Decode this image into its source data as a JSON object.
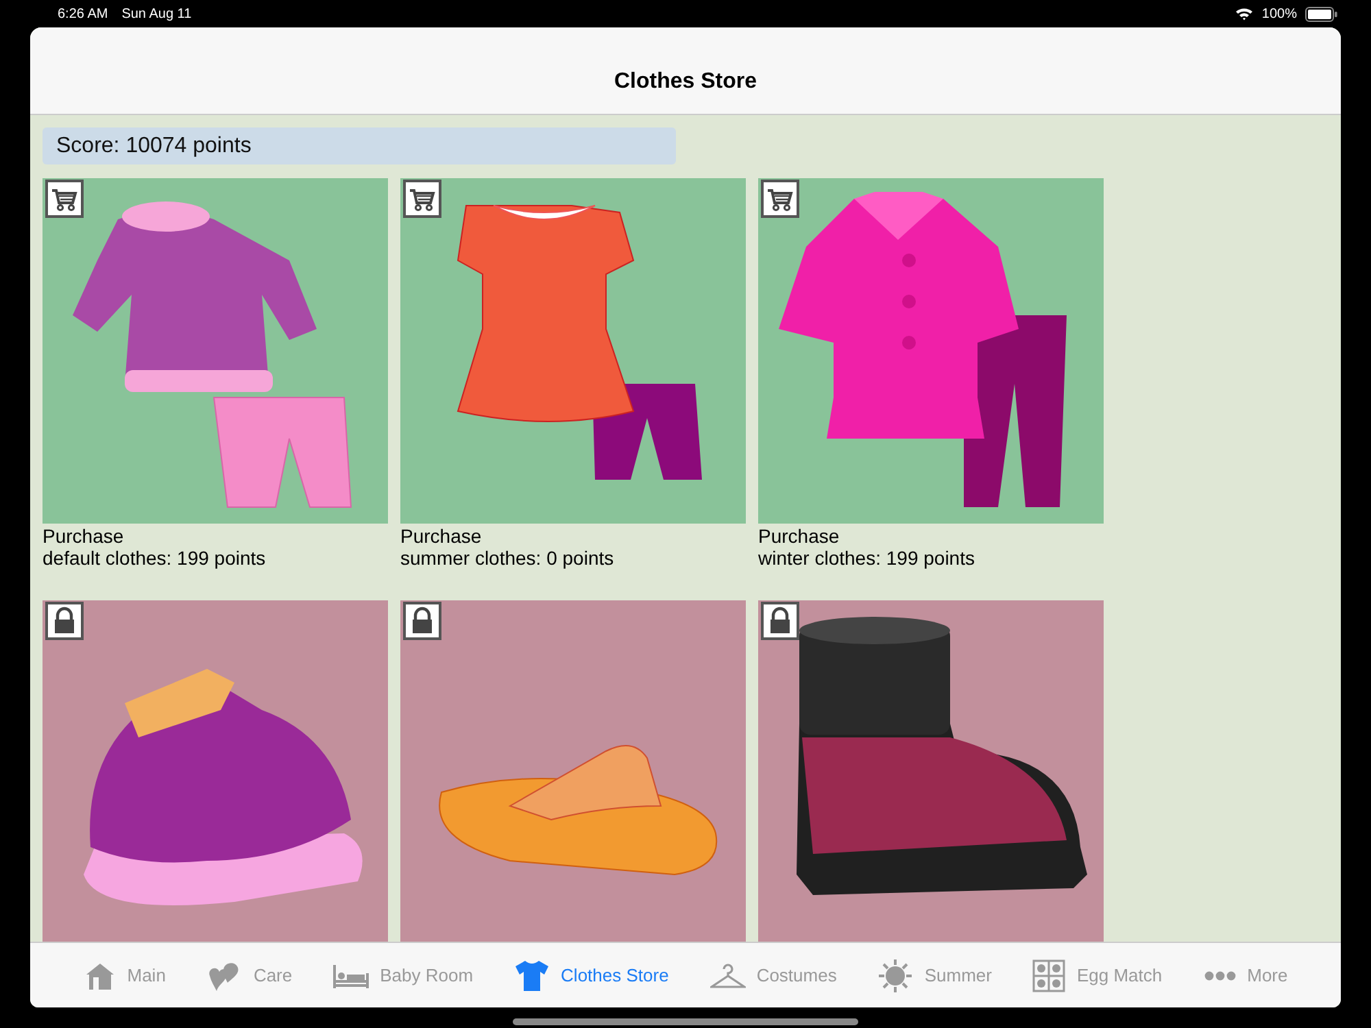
{
  "status_bar": {
    "time": "6:26 AM",
    "date": "Sun Aug 11",
    "battery": "100%"
  },
  "nav": {
    "title": "Clothes Store"
  },
  "score": "Score: 10074 points",
  "items": [
    {
      "kind": "purchase",
      "caption": [
        "Purchase",
        "default clothes: 199 points"
      ]
    },
    {
      "kind": "purchase",
      "caption": [
        "Purchase",
        "summer clothes: 0 points"
      ]
    },
    {
      "kind": "purchase",
      "caption": [
        "Purchase",
        "winter clothes: 199 points"
      ]
    },
    {
      "kind": "locked"
    },
    {
      "kind": "locked"
    },
    {
      "kind": "locked"
    }
  ],
  "tabs": [
    {
      "label": "Main",
      "selected": false
    },
    {
      "label": "Care",
      "selected": false
    },
    {
      "label": "Baby Room",
      "selected": false
    },
    {
      "label": "Clothes Store",
      "selected": true
    },
    {
      "label": "Costumes",
      "selected": false
    },
    {
      "label": "Summer",
      "selected": false
    },
    {
      "label": "Egg Match",
      "selected": false
    },
    {
      "label": "More",
      "selected": false
    }
  ]
}
